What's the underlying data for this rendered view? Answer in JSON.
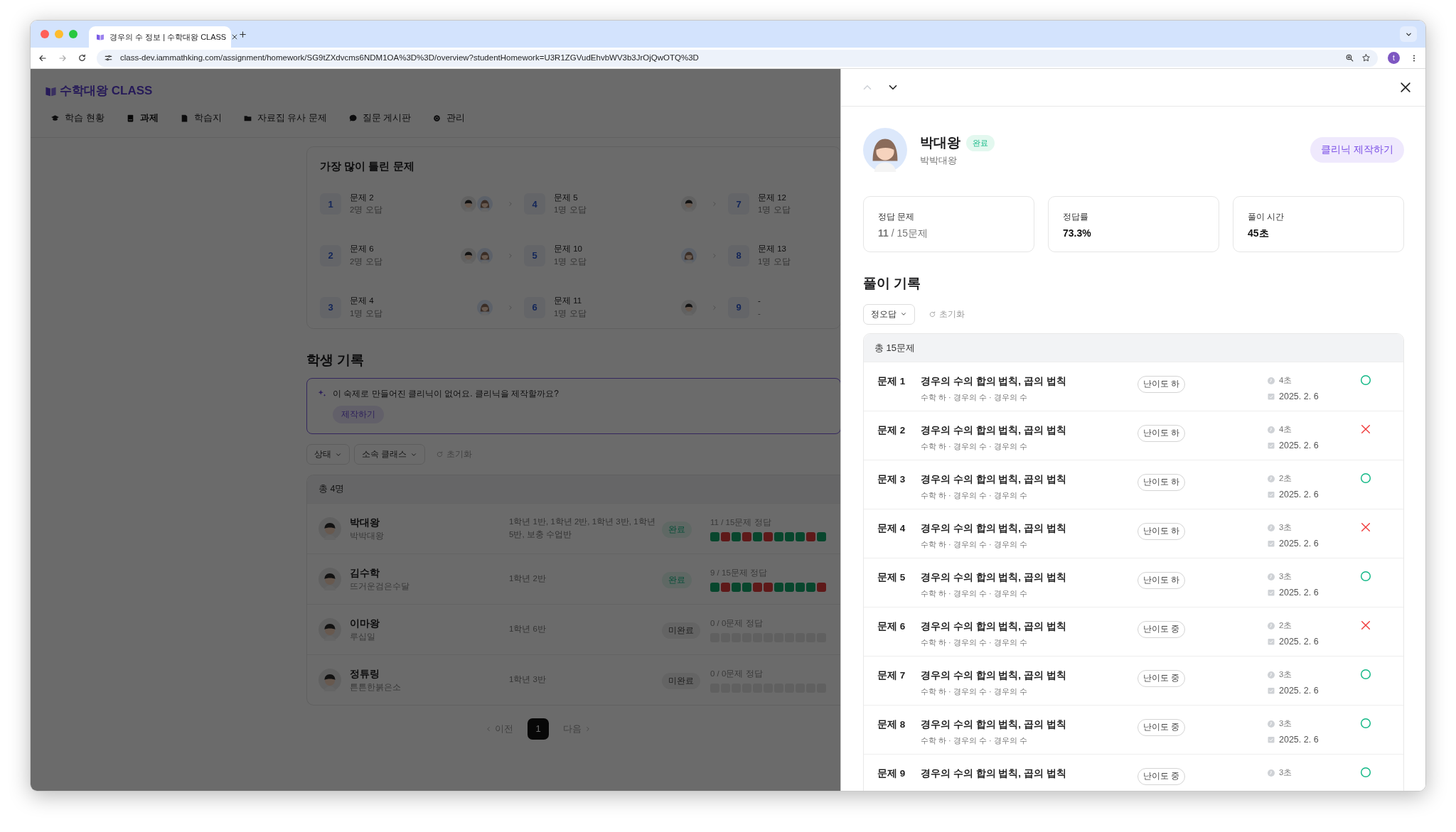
{
  "browser": {
    "tab_title": "경우의 수 정보 | 수학대왕 CLASS",
    "url": "class-dev.iammathking.com/assignment/homework/SG9tZXdvcms6NDM1OA%3D%3D/overview?studentHomework=U3R1ZGVudEhvbWV3b3JrOjQwOTQ%3D",
    "profile_initial": "t"
  },
  "app": {
    "logo": "수학대왕 CLASS",
    "nav": [
      {
        "label": "학습 현황",
        "selected": false
      },
      {
        "label": "과제",
        "selected": true
      },
      {
        "label": "학습지",
        "selected": false
      },
      {
        "label": "자료집 유사 문제",
        "selected": false
      },
      {
        "label": "질문 게시판",
        "selected": false
      },
      {
        "label": "관리",
        "selected": false
      }
    ]
  },
  "most_wrong": {
    "title": "가장 많이 틀린 문제",
    "items": [
      {
        "rank": "1",
        "problem": "문제 2",
        "wrong": "2명 오답",
        "wrong_students": [
          {
            "kind": "boy"
          },
          {
            "kind": "girl"
          }
        ]
      },
      {
        "rank": "4",
        "problem": "문제 5",
        "wrong": "1명 오답",
        "wrong_students": [
          {
            "kind": "boy"
          }
        ]
      },
      {
        "rank": "7",
        "problem": "문제 12",
        "wrong": "1명 오답"
      },
      {
        "rank": "2",
        "problem": "문제 6",
        "wrong": "2명 오답",
        "wrong_students": [
          {
            "kind": "boy"
          },
          {
            "kind": "girl"
          }
        ]
      },
      {
        "rank": "5",
        "problem": "문제 10",
        "wrong": "1명 오답",
        "wrong_students": [
          {
            "kind": "girl"
          }
        ]
      },
      {
        "rank": "8",
        "problem": "문제 13",
        "wrong": "1명 오답"
      },
      {
        "rank": "3",
        "problem": "문제 4",
        "wrong": "1명 오답",
        "wrong_students": [
          {
            "kind": "girl"
          }
        ]
      },
      {
        "rank": "6",
        "problem": "문제 11",
        "wrong": "1명 오답",
        "wrong_students": [
          {
            "kind": "boy"
          }
        ]
      },
      {
        "rank": "9",
        "problem": "-",
        "wrong": "-"
      }
    ]
  },
  "student_records": {
    "title": "학생 기록",
    "notice": "이 숙제로 만들어진 클리닉이 없어요. 클리닉을 제작할까요?",
    "notice_button": "제작하기",
    "filters": [
      "상태",
      "소속 클래스"
    ],
    "reset": "초기화",
    "total": "총 4명",
    "rows": [
      {
        "name": "박대왕",
        "nickname": "박박대왕",
        "classes": "1학년 1반, 1학년 2반, 1학년 3반, 1학년 5반, 보충 수업반",
        "status": "완료",
        "complete": true,
        "score": "11 / 15문제 정답",
        "answers": [
          {
            "correct": true
          },
          {
            "correct": false
          },
          {
            "correct": true
          },
          {
            "correct": false
          },
          {
            "correct": true
          },
          {
            "correct": false
          },
          {
            "correct": true
          },
          {
            "correct": true
          },
          {
            "correct": true
          },
          {
            "correct": false
          },
          {
            "correct": true
          }
        ]
      },
      {
        "name": "김수학",
        "nickname": "뜨거운검은수달",
        "classes": "1학년 2반",
        "status": "완료",
        "complete": true,
        "score": "9 / 15문제 정답",
        "answers": [
          {
            "correct": true
          },
          {
            "correct": false
          },
          {
            "correct": true
          },
          {
            "correct": true
          },
          {
            "correct": false
          },
          {
            "correct": false
          },
          {
            "correct": true
          },
          {
            "correct": true
          },
          {
            "correct": true
          },
          {
            "correct": true
          },
          {
            "correct": false
          }
        ]
      },
      {
        "name": "이마왕",
        "nickname": "루십일",
        "classes": "1학년 6반",
        "status": "미완료",
        "complete": false,
        "score": "0 / 0문제 정답",
        "answers": [
          {
            "answered": false
          },
          {
            "answered": false
          },
          {
            "answered": false
          },
          {
            "answered": false
          },
          {
            "answered": false
          },
          {
            "answered": false
          },
          {
            "answered": false
          },
          {
            "answered": false
          },
          {
            "answered": false
          },
          {
            "answered": false
          },
          {
            "answered": false
          }
        ]
      },
      {
        "name": "정튜링",
        "nickname": "튼튼한붉은소",
        "classes": "1학년 3반",
        "status": "미완료",
        "complete": false,
        "score": "0 / 0문제 정답",
        "answers": [
          {
            "answered": false
          },
          {
            "answered": false
          },
          {
            "answered": false
          },
          {
            "answered": false
          },
          {
            "answered": false
          },
          {
            "answered": false
          },
          {
            "answered": false
          },
          {
            "answered": false
          },
          {
            "answered": false
          },
          {
            "answered": false
          },
          {
            "answered": false
          }
        ]
      }
    ],
    "pagination": {
      "prev": "이전",
      "pages": [
        {
          "label": "1",
          "selected": true
        }
      ],
      "next": "다음"
    }
  },
  "drawer": {
    "prev_disabled": true,
    "next_disabled": false,
    "student": {
      "name": "박대왕",
      "status": "완료",
      "complete": true,
      "nickname": "박박대왕",
      "button": "클리닉 제작하기"
    },
    "stats": [
      {
        "label": "정답 문제",
        "value": "**11** / 15문제",
        "bold": false
      },
      {
        "label": "정답률",
        "value": "73.3%",
        "bold": true
      },
      {
        "label": "풀이 시간",
        "value": "45초",
        "bold": true
      }
    ],
    "history_title": "풀이 기록",
    "filter": "정오답",
    "reset": "초기화",
    "total": "총 15문제",
    "problems": [
      {
        "number": "문제 1",
        "title": "경우의 수의 합의 법칙, 곱의 법칙",
        "path": "수학 하 · 경우의 수 · 경우의 수",
        "difficulty": "난이도 하",
        "time": "4초",
        "date": "2025. 2. 6",
        "correct": true
      },
      {
        "number": "문제 2",
        "title": "경우의 수의 합의 법칙, 곱의 법칙",
        "path": "수학 하 · 경우의 수 · 경우의 수",
        "difficulty": "난이도 하",
        "time": "4초",
        "date": "2025. 2. 6",
        "correct": false
      },
      {
        "number": "문제 3",
        "title": "경우의 수의 합의 법칙, 곱의 법칙",
        "path": "수학 하 · 경우의 수 · 경우의 수",
        "difficulty": "난이도 하",
        "time": "2초",
        "date": "2025. 2. 6",
        "correct": true
      },
      {
        "number": "문제 4",
        "title": "경우의 수의 합의 법칙, 곱의 법칙",
        "path": "수학 하 · 경우의 수 · 경우의 수",
        "difficulty": "난이도 하",
        "time": "3초",
        "date": "2025. 2. 6",
        "correct": false
      },
      {
        "number": "문제 5",
        "title": "경우의 수의 합의 법칙, 곱의 법칙",
        "path": "수학 하 · 경우의 수 · 경우의 수",
        "difficulty": "난이도 하",
        "time": "3초",
        "date": "2025. 2. 6",
        "correct": true
      },
      {
        "number": "문제 6",
        "title": "경우의 수의 합의 법칙, 곱의 법칙",
        "path": "수학 하 · 경우의 수 · 경우의 수",
        "difficulty": "난이도 중",
        "time": "2초",
        "date": "2025. 2. 6",
        "correct": false
      },
      {
        "number": "문제 7",
        "title": "경우의 수의 합의 법칙, 곱의 법칙",
        "path": "수학 하 · 경우의 수 · 경우의 수",
        "difficulty": "난이도 중",
        "time": "3초",
        "date": "2025. 2. 6",
        "correct": true
      },
      {
        "number": "문제 8",
        "title": "경우의 수의 합의 법칙, 곱의 법칙",
        "path": "수학 하 · 경우의 수 · 경우의 수",
        "difficulty": "난이도 중",
        "time": "3초",
        "date": "2025. 2. 6",
        "correct": true
      },
      {
        "number": "문제 9",
        "title": "경우의 수의 합의 법칙, 곱의 법칙",
        "difficulty": "난이도 중",
        "time": "3초",
        "correct": true
      }
    ]
  }
}
